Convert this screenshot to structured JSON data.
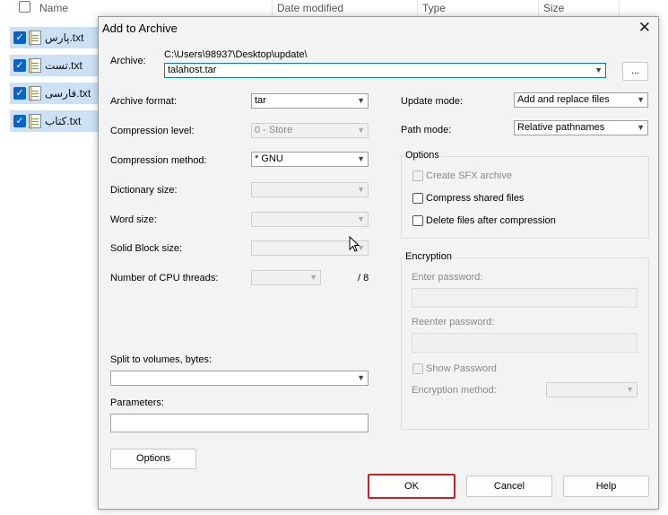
{
  "explorer": {
    "columns": [
      "Name",
      "Date modified",
      "Type",
      "Size"
    ],
    "files": [
      "پارس.txt",
      "تست.txt",
      "فارسی.txt",
      "کتاب.txt"
    ]
  },
  "dialog": {
    "title": "Add to Archive",
    "close_glyph": "✕",
    "archive_label": "Archive:",
    "archive_path": "C:\\Users\\98937\\Desktop\\update\\",
    "archive_name": "talahost.tar",
    "browse_label": "...",
    "left": {
      "archive_format_label": "Archive format:",
      "archive_format": "tar",
      "compression_level_label": "Compression level:",
      "compression_level": "0 - Store",
      "compression_method_label": "Compression method:",
      "compression_method": "*  GNU",
      "dictionary_size_label": "Dictionary size:",
      "word_size_label": "Word size:",
      "solid_block_label": "Solid Block size:",
      "cpu_threads_label": "Number of CPU threads:",
      "cpu_threads_total": "/ 8",
      "split_label": "Split to volumes, bytes:",
      "parameters_label": "Parameters:",
      "options_button": "Options"
    },
    "right": {
      "update_mode_label": "Update mode:",
      "update_mode": "Add and replace files",
      "path_mode_label": "Path mode:",
      "path_mode": "Relative pathnames",
      "options_group": "Options",
      "create_sfx": "Create SFX archive",
      "compress_shared": "Compress shared files",
      "delete_after": "Delete files after compression",
      "encryption_group": "Encryption",
      "enter_password": "Enter password:",
      "reenter_password": "Reenter password:",
      "show_password": "Show Password",
      "encryption_method": "Encryption method:"
    },
    "buttons": {
      "ok": "OK",
      "cancel": "Cancel",
      "help": "Help"
    }
  },
  "colors": {
    "accent": "#0078d7",
    "ok_highlight": "#c8202a",
    "selection": "#cce0f6"
  }
}
